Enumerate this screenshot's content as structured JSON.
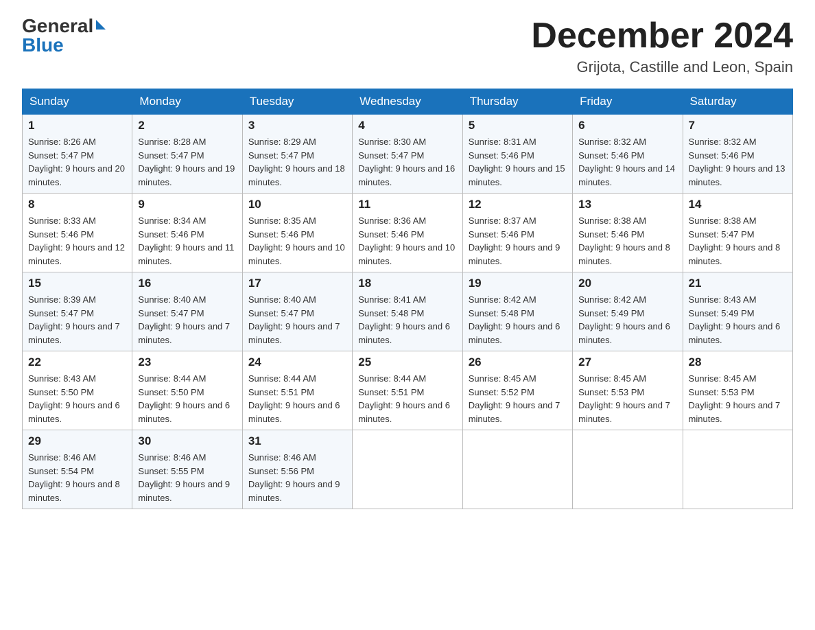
{
  "header": {
    "logo_general": "General",
    "logo_blue": "Blue",
    "month_year": "December 2024",
    "location": "Grijota, Castille and Leon, Spain"
  },
  "days_of_week": [
    "Sunday",
    "Monday",
    "Tuesday",
    "Wednesday",
    "Thursday",
    "Friday",
    "Saturday"
  ],
  "weeks": [
    [
      {
        "day": "1",
        "sunrise": "8:26 AM",
        "sunset": "5:47 PM",
        "daylight": "9 hours and 20 minutes."
      },
      {
        "day": "2",
        "sunrise": "8:28 AM",
        "sunset": "5:47 PM",
        "daylight": "9 hours and 19 minutes."
      },
      {
        "day": "3",
        "sunrise": "8:29 AM",
        "sunset": "5:47 PM",
        "daylight": "9 hours and 18 minutes."
      },
      {
        "day": "4",
        "sunrise": "8:30 AM",
        "sunset": "5:47 PM",
        "daylight": "9 hours and 16 minutes."
      },
      {
        "day": "5",
        "sunrise": "8:31 AM",
        "sunset": "5:46 PM",
        "daylight": "9 hours and 15 minutes."
      },
      {
        "day": "6",
        "sunrise": "8:32 AM",
        "sunset": "5:46 PM",
        "daylight": "9 hours and 14 minutes."
      },
      {
        "day": "7",
        "sunrise": "8:32 AM",
        "sunset": "5:46 PM",
        "daylight": "9 hours and 13 minutes."
      }
    ],
    [
      {
        "day": "8",
        "sunrise": "8:33 AM",
        "sunset": "5:46 PM",
        "daylight": "9 hours and 12 minutes."
      },
      {
        "day": "9",
        "sunrise": "8:34 AM",
        "sunset": "5:46 PM",
        "daylight": "9 hours and 11 minutes."
      },
      {
        "day": "10",
        "sunrise": "8:35 AM",
        "sunset": "5:46 PM",
        "daylight": "9 hours and 10 minutes."
      },
      {
        "day": "11",
        "sunrise": "8:36 AM",
        "sunset": "5:46 PM",
        "daylight": "9 hours and 10 minutes."
      },
      {
        "day": "12",
        "sunrise": "8:37 AM",
        "sunset": "5:46 PM",
        "daylight": "9 hours and 9 minutes."
      },
      {
        "day": "13",
        "sunrise": "8:38 AM",
        "sunset": "5:46 PM",
        "daylight": "9 hours and 8 minutes."
      },
      {
        "day": "14",
        "sunrise": "8:38 AM",
        "sunset": "5:47 PM",
        "daylight": "9 hours and 8 minutes."
      }
    ],
    [
      {
        "day": "15",
        "sunrise": "8:39 AM",
        "sunset": "5:47 PM",
        "daylight": "9 hours and 7 minutes."
      },
      {
        "day": "16",
        "sunrise": "8:40 AM",
        "sunset": "5:47 PM",
        "daylight": "9 hours and 7 minutes."
      },
      {
        "day": "17",
        "sunrise": "8:40 AM",
        "sunset": "5:47 PM",
        "daylight": "9 hours and 7 minutes."
      },
      {
        "day": "18",
        "sunrise": "8:41 AM",
        "sunset": "5:48 PM",
        "daylight": "9 hours and 6 minutes."
      },
      {
        "day": "19",
        "sunrise": "8:42 AM",
        "sunset": "5:48 PM",
        "daylight": "9 hours and 6 minutes."
      },
      {
        "day": "20",
        "sunrise": "8:42 AM",
        "sunset": "5:49 PM",
        "daylight": "9 hours and 6 minutes."
      },
      {
        "day": "21",
        "sunrise": "8:43 AM",
        "sunset": "5:49 PM",
        "daylight": "9 hours and 6 minutes."
      }
    ],
    [
      {
        "day": "22",
        "sunrise": "8:43 AM",
        "sunset": "5:50 PM",
        "daylight": "9 hours and 6 minutes."
      },
      {
        "day": "23",
        "sunrise": "8:44 AM",
        "sunset": "5:50 PM",
        "daylight": "9 hours and 6 minutes."
      },
      {
        "day": "24",
        "sunrise": "8:44 AM",
        "sunset": "5:51 PM",
        "daylight": "9 hours and 6 minutes."
      },
      {
        "day": "25",
        "sunrise": "8:44 AM",
        "sunset": "5:51 PM",
        "daylight": "9 hours and 6 minutes."
      },
      {
        "day": "26",
        "sunrise": "8:45 AM",
        "sunset": "5:52 PM",
        "daylight": "9 hours and 7 minutes."
      },
      {
        "day": "27",
        "sunrise": "8:45 AM",
        "sunset": "5:53 PM",
        "daylight": "9 hours and 7 minutes."
      },
      {
        "day": "28",
        "sunrise": "8:45 AM",
        "sunset": "5:53 PM",
        "daylight": "9 hours and 7 minutes."
      }
    ],
    [
      {
        "day": "29",
        "sunrise": "8:46 AM",
        "sunset": "5:54 PM",
        "daylight": "9 hours and 8 minutes."
      },
      {
        "day": "30",
        "sunrise": "8:46 AM",
        "sunset": "5:55 PM",
        "daylight": "9 hours and 9 minutes."
      },
      {
        "day": "31",
        "sunrise": "8:46 AM",
        "sunset": "5:56 PM",
        "daylight": "9 hours and 9 minutes."
      },
      null,
      null,
      null,
      null
    ]
  ]
}
